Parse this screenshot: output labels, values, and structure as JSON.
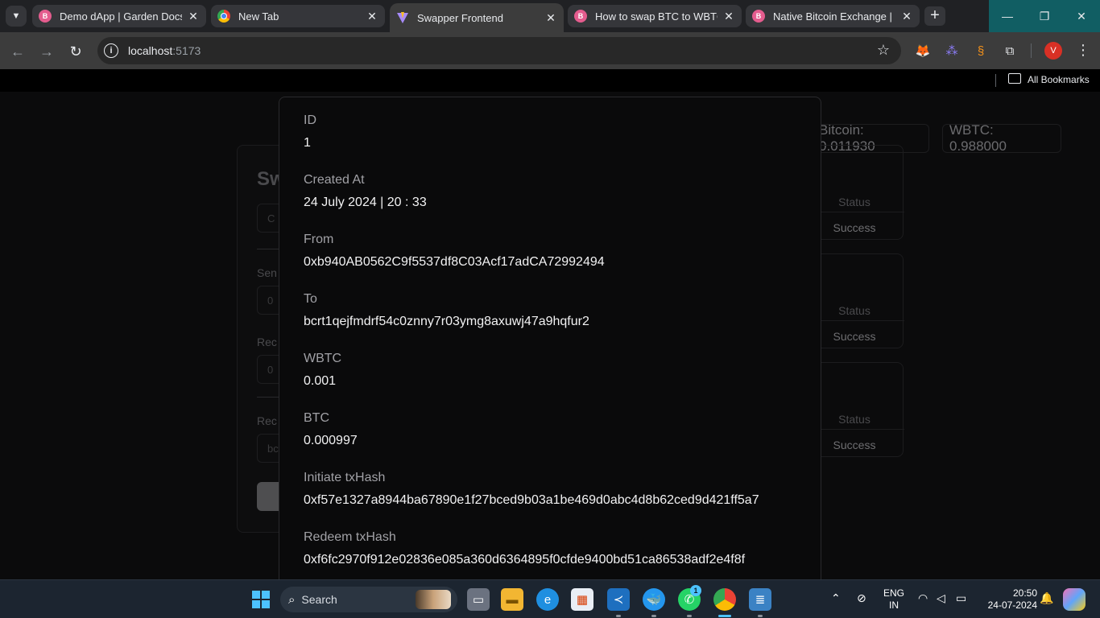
{
  "browser": {
    "tabs": [
      {
        "title": "Demo dApp | Garden Docs",
        "icon": "garden-icon"
      },
      {
        "title": "New Tab",
        "icon": "chrome-icon"
      },
      {
        "title": "Swapper Frontend",
        "icon": "vite-icon"
      },
      {
        "title": "How to swap BTC to WBTC |",
        "icon": "garden-icon"
      },
      {
        "title": "Native Bitcoin Exchange | Ga",
        "icon": "garden-icon"
      }
    ],
    "active_tab": 2,
    "address_host": "localhost",
    "address_port": ":5173",
    "profile_initial": "V",
    "bookmarks_label": "All Bookmarks"
  },
  "page": {
    "swap_title": "Sw",
    "balances": [
      "Bitcoin: 0.011930",
      "WBTC: 0.988000"
    ],
    "form_labels": [
      "Sen",
      "Rec",
      "Rec"
    ],
    "form_boxes": [
      "C",
      "0",
      "0",
      "bc"
    ],
    "orders": [
      {
        "status_header": "Status",
        "status": "Success"
      },
      {
        "status_header": "Status",
        "status": "Success"
      },
      {
        "status_header": "Status",
        "status": "Success"
      }
    ]
  },
  "modal": {
    "fields": [
      {
        "label": "ID",
        "value": "1"
      },
      {
        "label": "Created At",
        "value": "24 July 2024 | 20 : 33"
      },
      {
        "label": "From",
        "value": "0xb940AB0562C9f5537df8C03Acf17adCA72992494"
      },
      {
        "label": "To",
        "value": "bcrt1qejfmdrf54c0znny7r03ymg8axuwj47a9hqfur2"
      },
      {
        "label": "WBTC",
        "value": "0.001"
      },
      {
        "label": "BTC",
        "value": "0.000997"
      },
      {
        "label": "Initiate txHash",
        "value": "0xf57e1327a8944ba67890e1f27bced9b03a1be469d0abc4d8b62ced9d421ff5a7"
      },
      {
        "label": "Redeem txHash",
        "value": "0xf6fc2970f912e02836e085a360d6364895f0cfde9400bd51ca86538adf2e4f8f"
      }
    ]
  },
  "taskbar": {
    "search_label": "Search",
    "whatsapp_badge": "1",
    "language": "ENG",
    "region": "IN",
    "time": "20:50",
    "date": "24-07-2024"
  }
}
